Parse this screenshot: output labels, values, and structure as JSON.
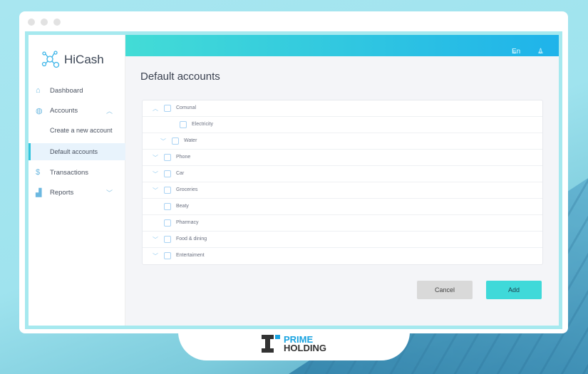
{
  "app": {
    "name": "HiCash"
  },
  "header": {
    "language": "En"
  },
  "sidebar": {
    "items": [
      {
        "label": "Dashboard",
        "icon": "home-icon"
      },
      {
        "label": "Accounts",
        "icon": "piggy-bank-icon"
      },
      {
        "label": "Create a new account"
      },
      {
        "label": "Default accounts"
      },
      {
        "label": "Transactions",
        "icon": "dollar-icon"
      },
      {
        "label": "Reports",
        "icon": "chart-icon"
      }
    ]
  },
  "page": {
    "title": "Default accounts"
  },
  "accounts": [
    {
      "label": "Comunal",
      "arrow": "up",
      "level": 0
    },
    {
      "label": "Electricity",
      "arrow": "",
      "level": 2
    },
    {
      "label": "Water",
      "arrow": "down",
      "level": 1
    },
    {
      "label": "Phone",
      "arrow": "down",
      "level": 0
    },
    {
      "label": "Car",
      "arrow": "down",
      "level": 0
    },
    {
      "label": "Groceries",
      "arrow": "down",
      "level": 0
    },
    {
      "label": "Beaty",
      "arrow": "",
      "level": 0
    },
    {
      "label": "Pharmacy",
      "arrow": "",
      "level": 0
    },
    {
      "label": "Food & dining",
      "arrow": "down",
      "level": 0
    },
    {
      "label": "Entertaiment",
      "arrow": "down",
      "level": 0
    }
  ],
  "buttons": {
    "cancel": "Cancel",
    "add": "Add"
  },
  "branding": {
    "line1": "PRIME",
    "line2": "HOLDING"
  },
  "colors": {
    "accent": "#3fd9d9",
    "header_start": "#43dcd6",
    "header_end": "#1fb3ea"
  }
}
